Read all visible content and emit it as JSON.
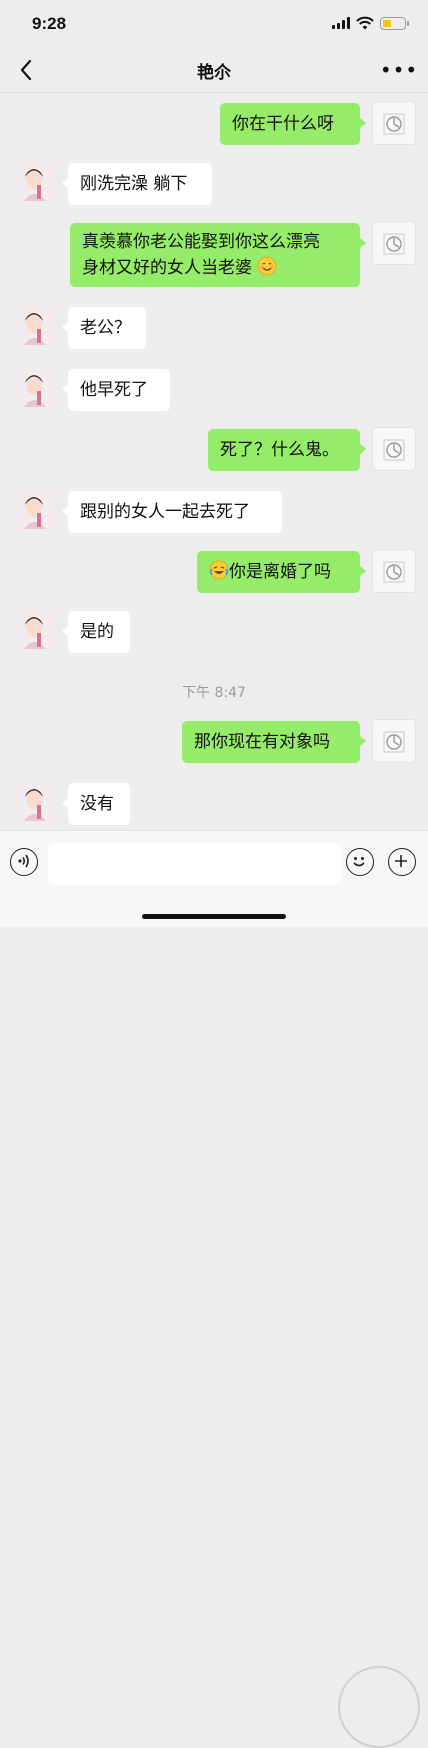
{
  "status_bar": {
    "time": "9:28",
    "battery_color": "#f5c400"
  },
  "nav": {
    "title": "艳尒",
    "back_icon": "chevron-left-icon",
    "more_icon": "more-dots-icon",
    "more_label": "•••"
  },
  "colors": {
    "me_bubble": "#95ec69",
    "her_bubble": "#ffffff",
    "background": "#ededed"
  },
  "messages": [
    {
      "sender": "me",
      "lines": [
        "你在干什么呀"
      ]
    },
    {
      "sender": "her",
      "lines": [
        "刚洗完澡 躺下"
      ]
    },
    {
      "sender": "me",
      "lines": [
        "真羡慕你老公能娶到你这么漂亮",
        "身材又好的女人当老婆"
      ],
      "trailing_emoji": "smile-emoji"
    },
    {
      "sender": "her",
      "lines": [
        "老公？"
      ]
    },
    {
      "sender": "her",
      "lines": [
        "他早死了"
      ]
    },
    {
      "sender": "me",
      "lines": [
        "死了？什么鬼。"
      ]
    },
    {
      "sender": "her",
      "lines": [
        "跟别的女人一起去死了"
      ]
    },
    {
      "sender": "me",
      "lines": [
        "你是离婚了吗"
      ],
      "leading_emoji": "laugh-cry-emoji"
    },
    {
      "sender": "her",
      "lines": [
        "是的"
      ]
    },
    {
      "sender": "me",
      "lines": [
        "那你现在有对象吗"
      ]
    },
    {
      "sender": "her",
      "lines": [
        "没有"
      ]
    }
  ],
  "time_divider": "下午 8:47",
  "input_bar": {
    "voice_icon": "voice-icon",
    "emoji_icon": "emoji-icon",
    "plus_icon": "plus-icon",
    "text": ""
  }
}
